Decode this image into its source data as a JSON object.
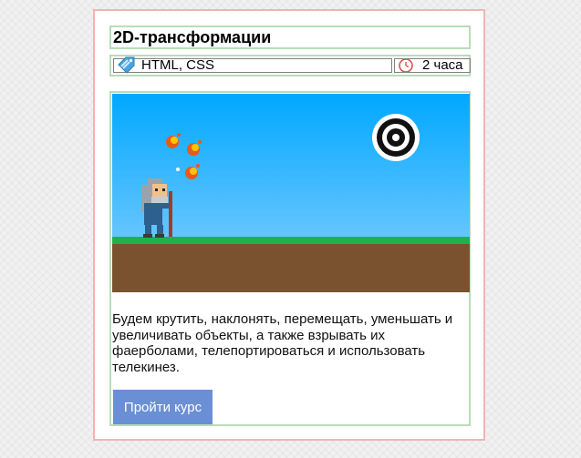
{
  "course": {
    "title": "2D-трансформации",
    "tags": "HTML, CSS",
    "duration": "2 часа",
    "description": "Будем крутить, наклонять, перемещать, уменьшать и увеличивать объекты, а также взрывать их фаерболами, телепортироваться и использовать телекинез.",
    "button_label": "Пройти курс"
  },
  "icons": {
    "tags": "tag-icon",
    "duration": "clock-icon"
  },
  "colors": {
    "card_border": "#f2b4b4",
    "section_border": "#b9dcb9",
    "button": "#6b8fd4",
    "sky": "#1aa6f0",
    "grass": "#1fb24a",
    "ground": "#7a5230"
  }
}
